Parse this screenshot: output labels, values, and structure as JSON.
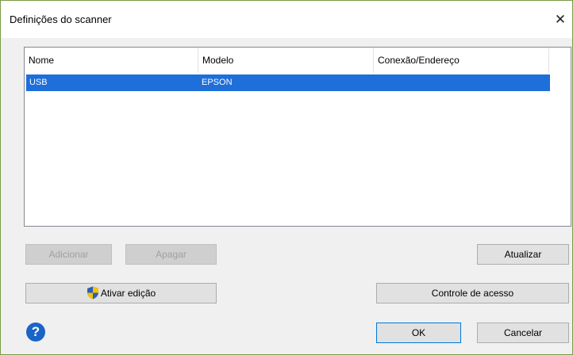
{
  "window": {
    "title": "Definições do scanner",
    "close_glyph": "✕"
  },
  "table": {
    "columns": [
      "Nome",
      "Modelo",
      "Conexão/Endereço"
    ],
    "rows": [
      {
        "nome": "USB",
        "modelo": "EPSON",
        "conexao": ""
      }
    ],
    "selected_row_color": "#1e6fd9"
  },
  "buttons": {
    "add": "Adicionar",
    "delete": "Apagar",
    "update": "Atualizar",
    "enable_edit": "Ativar edição",
    "access_control": "Controle de acesso",
    "ok": "OK",
    "cancel": "Cancelar"
  },
  "help": {
    "glyph": "?",
    "icon": "help-icon"
  },
  "colors": {
    "help_blue": "#1a64c8",
    "focus_border": "#0078d7"
  }
}
